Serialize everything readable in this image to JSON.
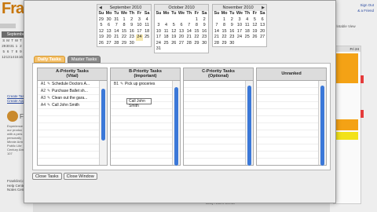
{
  "background": {
    "logo_text": "Fran",
    "mini_calendar": {
      "header": "September",
      "day_names": [
        "S",
        "M",
        "T",
        "W",
        "T",
        "F",
        "S"
      ],
      "rows": [
        [
          "29",
          "30",
          "31",
          "1",
          "2",
          "3",
          "4"
        ],
        [
          "5",
          "6",
          "7",
          "8",
          "9",
          "10",
          "11"
        ],
        [
          "12",
          "13",
          "14",
          "15",
          "16",
          "17",
          "18"
        ]
      ]
    },
    "links": [
      "Create Task",
      "Create Appoi"
    ],
    "company_name": "Fra",
    "body_text": [
      "Experience",
      "our produc",
      "with a pers",
      "personally",
      "Minnie Arm",
      "Public Libr",
      "Century Am",
      "107"
    ],
    "footer_links": [
      "FranklinCov",
      "Help Center",
      "Notes Cente"
    ],
    "right_links": [
      "Sign Out",
      "& a Friend"
    ],
    "right_toolbar": "Printable View",
    "right_date": "Fri 24",
    "bottom_label": "Daily Notes Center"
  },
  "calendars": [
    {
      "month": "September 2010",
      "prev": "◀",
      "next": "",
      "day_names": [
        "Su",
        "Mo",
        "Tu",
        "We",
        "Th",
        "Fr",
        "Sa"
      ],
      "weeks": [
        [
          "29",
          "30",
          "31",
          "1",
          "2",
          "3",
          "4"
        ],
        [
          "5",
          "6",
          "7",
          "8",
          "9",
          "10",
          "11"
        ],
        [
          "12",
          "13",
          "14",
          "15",
          "16",
          "17",
          "18"
        ],
        [
          "19",
          "20",
          "21",
          "22",
          "23",
          "24",
          "25"
        ],
        [
          "26",
          "27",
          "28",
          "29",
          "30",
          "",
          ""
        ]
      ],
      "highlight": "24"
    },
    {
      "month": "October 2010",
      "prev": "",
      "next": "",
      "day_names": [
        "Su",
        "Mo",
        "Tu",
        "We",
        "Th",
        "Fr",
        "Sa"
      ],
      "weeks": [
        [
          "",
          "",
          "",
          "",
          "",
          "1",
          "2"
        ],
        [
          "3",
          "4",
          "5",
          "6",
          "7",
          "8",
          "9"
        ],
        [
          "10",
          "11",
          "12",
          "13",
          "14",
          "15",
          "16"
        ],
        [
          "17",
          "18",
          "19",
          "20",
          "21",
          "22",
          "23"
        ],
        [
          "24",
          "25",
          "26",
          "27",
          "28",
          "29",
          "30"
        ],
        [
          "31",
          "",
          "",
          "",
          "",
          "",
          ""
        ]
      ]
    },
    {
      "month": "November 2010",
      "prev": "",
      "next": "▶",
      "day_names": [
        "Su",
        "Mo",
        "Tu",
        "We",
        "Th",
        "Fr",
        "Sa"
      ],
      "weeks": [
        [
          "",
          "1",
          "2",
          "3",
          "4",
          "5",
          "6"
        ],
        [
          "7",
          "8",
          "9",
          "10",
          "11",
          "12",
          "13"
        ],
        [
          "14",
          "15",
          "16",
          "17",
          "18",
          "19",
          "20"
        ],
        [
          "21",
          "22",
          "23",
          "24",
          "25",
          "26",
          "27"
        ],
        [
          "28",
          "29",
          "30",
          "",
          "",
          "",
          ""
        ]
      ]
    }
  ],
  "tabs": [
    "Daily Tasks",
    "Master Tasks"
  ],
  "columns": [
    {
      "title_line1": "A-Priority Tasks",
      "title_line2": "(Vital)",
      "tasks": [
        {
          "num": "A1",
          "text": "Schedule Doctors A..."
        },
        {
          "num": "A2",
          "text": "Purchase Ballet sh..."
        },
        {
          "num": "A3",
          "text": "Clean out the gara..."
        },
        {
          "num": "A4",
          "text": "Call John Smith"
        }
      ]
    },
    {
      "title_line1": "B-Priority Tasks",
      "title_line2": "(Important)",
      "tasks": [
        {
          "num": "B1",
          "text": "Pick up groceries"
        }
      ],
      "editing_value": "Call John Smith"
    },
    {
      "title_line1": "C-Priority Tasks",
      "title_line2": "(Optional)",
      "tasks": []
    },
    {
      "title_line1": "Unranked",
      "title_line2": "",
      "tasks": []
    }
  ],
  "buttons": {
    "close_tasks": "Close Tasks",
    "close_window": "Close Window"
  },
  "colors": {
    "active_tab": "#f5c16b",
    "scroll_thumb": "#3b78d8",
    "accent_orange": "#f4a215"
  }
}
